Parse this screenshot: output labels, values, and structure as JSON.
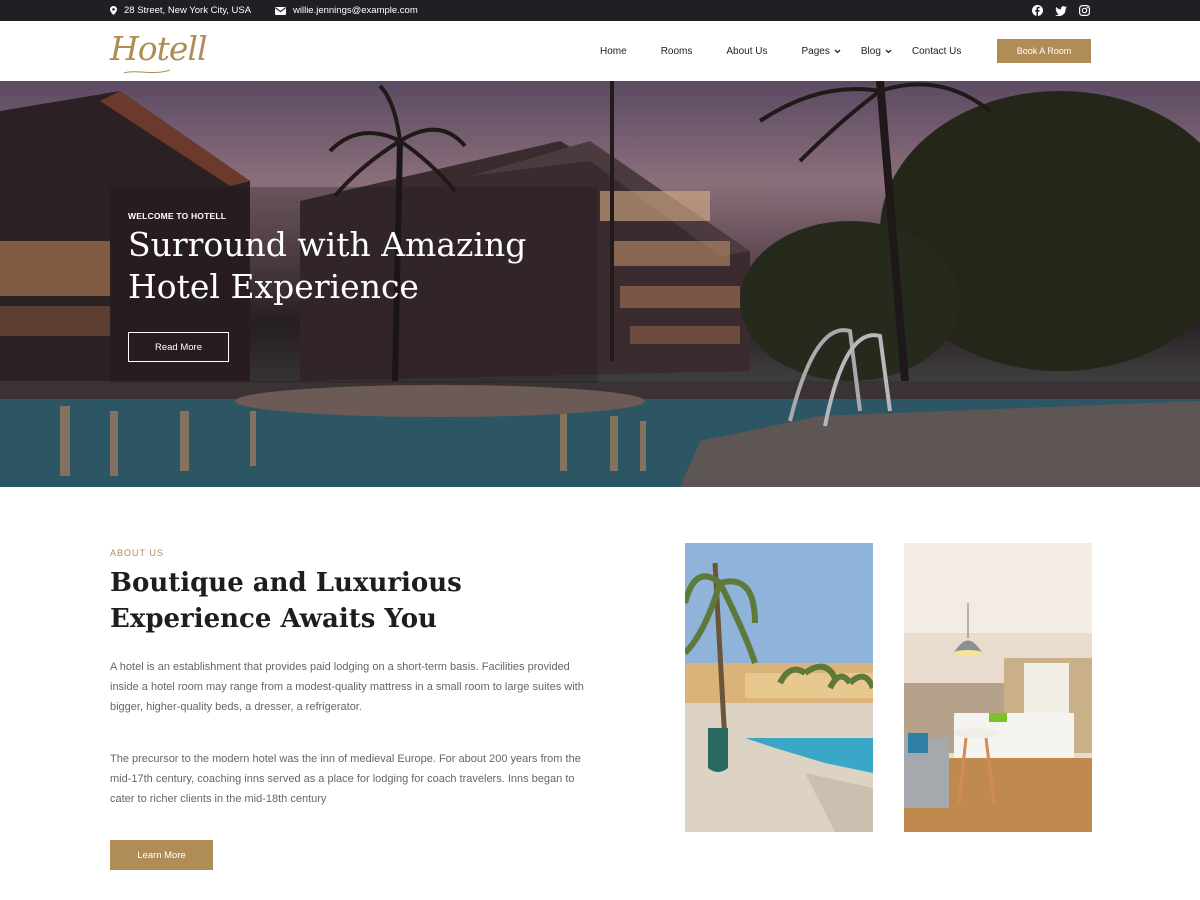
{
  "topbar": {
    "address": "28 Street, New York City, USA",
    "email": "willie.jennings@example.com",
    "social": [
      "facebook-icon",
      "twitter-icon",
      "instagram-icon"
    ]
  },
  "header": {
    "logo": "Hotell",
    "nav": [
      {
        "label": "Home",
        "dropdown": false
      },
      {
        "label": "Rooms",
        "dropdown": false
      },
      {
        "label": "About Us",
        "dropdown": false
      },
      {
        "label": "Pages",
        "dropdown": true
      },
      {
        "label": "Blog",
        "dropdown": true
      },
      {
        "label": "Contact Us",
        "dropdown": false
      }
    ],
    "cta": "Book A Room"
  },
  "hero": {
    "eyebrow": "WELCOME TO HOTELL",
    "title": "Surround with Amazing Hotel Experience",
    "button": "Read More"
  },
  "about": {
    "eyebrow": "ABOUT US",
    "title": "Boutique and Luxurious Experience Awaits You",
    "paragraphs": [
      "A hotel is an establishment that provides paid lodging on a short-term basis. Facilities provided inside a hotel room may range from a modest-quality mattress in a small room to large suites with bigger, higher-quality beds, a dresser, a refrigerator.",
      "The precursor to the modern hotel was the inn of medieval Europe. For about 200 years from the mid-17th century, coaching inns served as a place for lodging for coach travelers. Inns began to cater to richer clients in the mid-18th century"
    ],
    "button": "Learn More"
  },
  "colors": {
    "accent": "#b08d57",
    "topbar": "#1f1f24",
    "heading": "#1e1e1e",
    "body_text": "#666666"
  }
}
